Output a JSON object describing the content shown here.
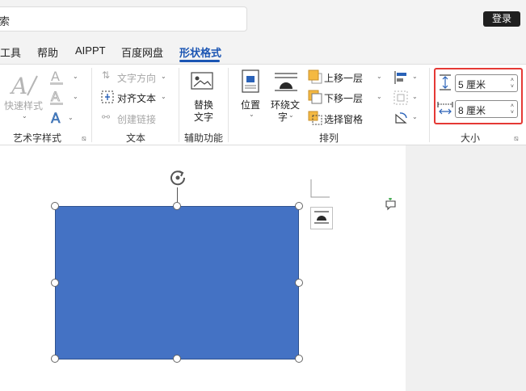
{
  "search": {
    "text": "索"
  },
  "header": {
    "login_label": "登录"
  },
  "menu": {
    "items": [
      {
        "label": "工具"
      },
      {
        "label": "帮助"
      },
      {
        "label": "AIPPT"
      },
      {
        "label": "百度网盘"
      },
      {
        "label": "形状格式"
      }
    ]
  },
  "ribbon": {
    "art": {
      "quick_styles": "快速样式",
      "group": "艺术字样式"
    },
    "text": {
      "direction": "文字方向",
      "align": "对齐文本",
      "link": "创建链接",
      "group": "文本"
    },
    "aux": {
      "alt_text_1": "替换",
      "alt_text_2": "文字",
      "group": "辅助功能"
    },
    "arrange": {
      "position": "位置",
      "wrap_1": "环绕文",
      "wrap_2": "字",
      "forward": "上移一层",
      "backward": "下移一层",
      "pane": "选择窗格",
      "group": "排列"
    },
    "size": {
      "height": "5 厘米",
      "width": "8 厘米",
      "group": "大小"
    }
  },
  "colors": {
    "accent": "#1b55b3",
    "shape_fill": "#4472c4",
    "highlight": "#e53935"
  }
}
